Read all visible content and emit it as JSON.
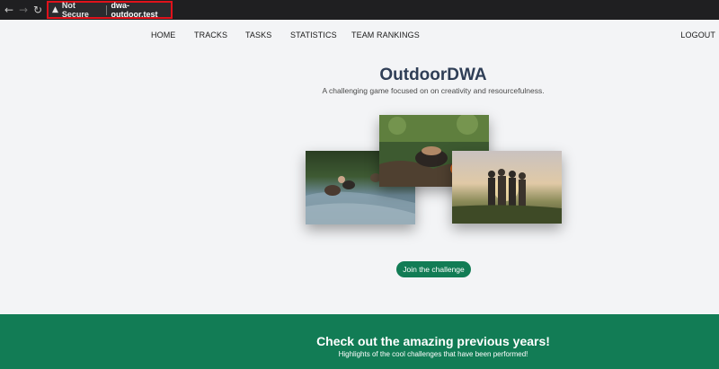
{
  "browser": {
    "security_label": "Not Secure",
    "url": "dwa-outdoor.test",
    "icons": [
      "back-arrow-icon",
      "forward-arrow-icon",
      "reload-icon",
      "warning-icon"
    ]
  },
  "nav": {
    "home": "HOME",
    "tracks": "TRACKS",
    "tasks": "TASKS",
    "statistics": "STATISTICS",
    "team_rankings": "TEAM RANKINGS",
    "logout": "LOGOUT"
  },
  "hero": {
    "title": "OutdoorDWA",
    "subtitle": "A challenging game focused on on creativity and resourcefulness.",
    "cta_label": "Join the challenge"
  },
  "band": {
    "title": "Check out the amazing previous years!",
    "subtitle": "Highlights of the cool challenges that have been performed!"
  },
  "colors": {
    "accent": "#127c55",
    "title": "#2f3e56",
    "url_highlight": "#e0121b"
  }
}
